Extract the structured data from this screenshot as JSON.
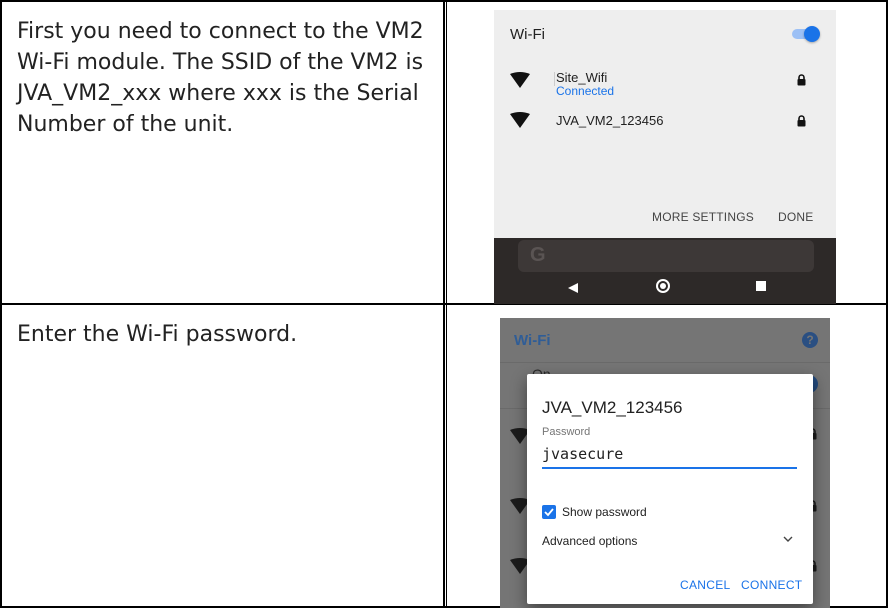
{
  "rows": [
    {
      "instruction": "First you need to connect to the VM2 Wi-Fi module. The SSID of the VM2 is JVA_VM2_xxx where xxx is the Serial Number of the unit."
    },
    {
      "instruction": "Enter the Wi-Fi password."
    }
  ],
  "wifi_panel": {
    "title": "Wi-Fi",
    "toggle_on": true,
    "networks": [
      {
        "ssid": "Site_Wifi",
        "status": "Connected",
        "icon": "wifi-icon",
        "secured_icon": "lock-icon"
      },
      {
        "ssid": "JVA_VM2_123456",
        "status": "",
        "icon": "wifi-icon",
        "secured_icon": "lock-icon"
      }
    ],
    "more_settings_label": "MORE SETTINGS",
    "done_label": "DONE",
    "search_glyph": "G",
    "nav_icons": [
      "back-icon",
      "home-icon",
      "recents-icon"
    ]
  },
  "password_dialog": {
    "background_title": "Wi-Fi",
    "background_toggle_label": "On",
    "help_glyph": "?",
    "network_name": "JVA_VM2_123456",
    "password_label": "Password",
    "password_value": "jvasecure",
    "show_password_label": "Show password",
    "show_password_checked": true,
    "advanced_options_label": "Advanced options",
    "cancel_label": "CANCEL",
    "connect_label": "CONNECT"
  },
  "colors": {
    "accent": "#1a73e8",
    "dark_title": "#2f5d97",
    "nav_bar": "#2d2928"
  }
}
